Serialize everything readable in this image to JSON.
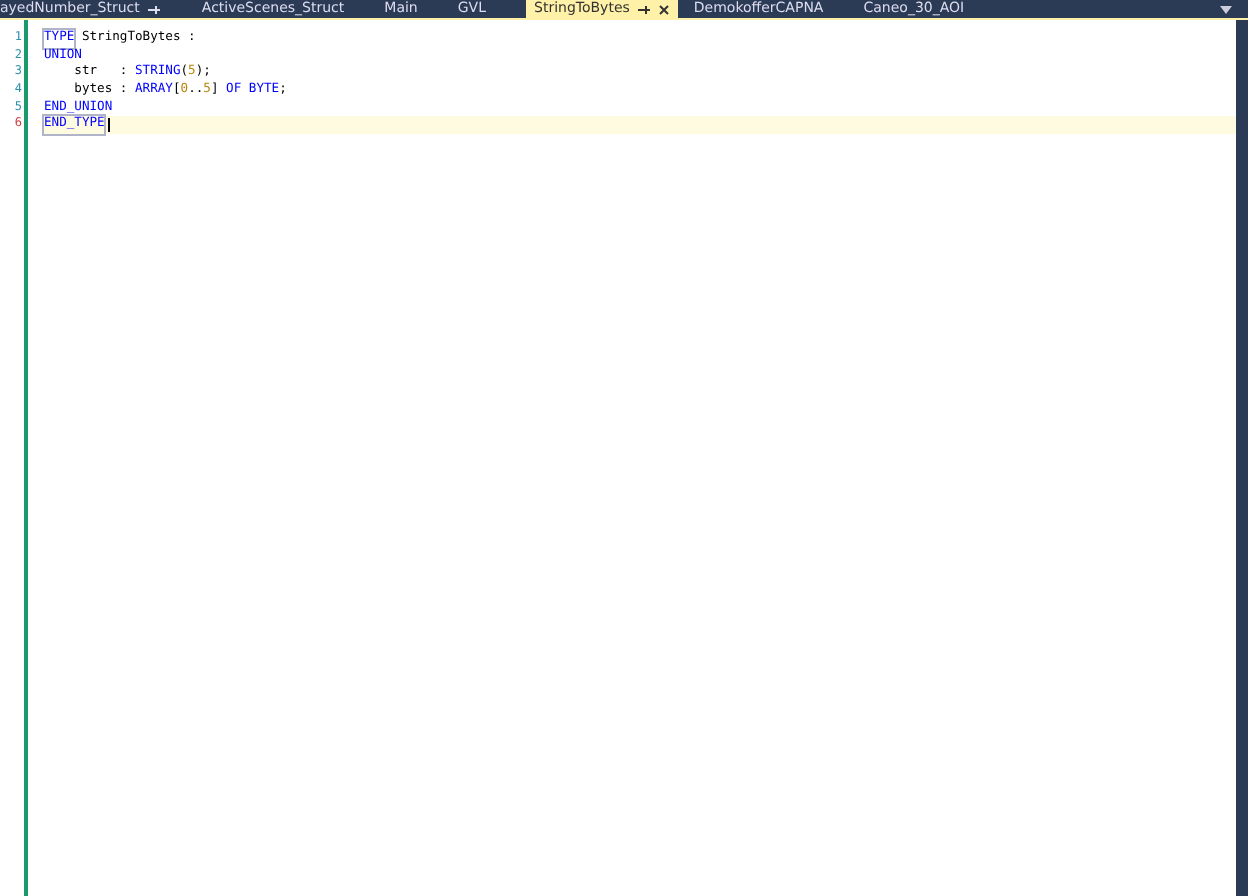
{
  "tabs": [
    {
      "label": "ayedNumber_Struct",
      "selected": false,
      "pinned": true,
      "closable": false
    },
    {
      "label": "ActiveScenes_Struct",
      "selected": false,
      "pinned": false,
      "closable": false
    },
    {
      "label": "Main",
      "selected": false,
      "pinned": false,
      "closable": false
    },
    {
      "label": "GVL",
      "selected": false,
      "pinned": false,
      "closable": false
    },
    {
      "label": "StringToBytes",
      "selected": true,
      "pinned": true,
      "closable": true
    },
    {
      "label": "DemokofferCAPNA",
      "selected": false,
      "pinned": false,
      "closable": false
    },
    {
      "label": "Caneo_30_AOI",
      "selected": false,
      "pinned": false,
      "closable": false
    }
  ],
  "editor": {
    "lines": [
      {
        "number": "1",
        "changed": false,
        "current": false,
        "tokens": [
          {
            "kind": "keyword",
            "text": "TYPE",
            "boxed": true
          },
          {
            "kind": "plain",
            "text": " StringToBytes :"
          }
        ]
      },
      {
        "number": "2",
        "changed": false,
        "current": false,
        "tokens": [
          {
            "kind": "keyword",
            "text": "UNION"
          }
        ]
      },
      {
        "number": "3",
        "changed": false,
        "current": false,
        "tokens": [
          {
            "kind": "plain",
            "text": "    str   : "
          },
          {
            "kind": "keyword",
            "text": "STRING"
          },
          {
            "kind": "plain",
            "text": "("
          },
          {
            "kind": "number",
            "text": "5"
          },
          {
            "kind": "plain",
            "text": ");"
          }
        ]
      },
      {
        "number": "4",
        "changed": false,
        "current": false,
        "tokens": [
          {
            "kind": "plain",
            "text": "    bytes : "
          },
          {
            "kind": "keyword",
            "text": "ARRAY"
          },
          {
            "kind": "plain",
            "text": "["
          },
          {
            "kind": "number",
            "text": "0"
          },
          {
            "kind": "plain",
            "text": ".."
          },
          {
            "kind": "number",
            "text": "5"
          },
          {
            "kind": "plain",
            "text": "] "
          },
          {
            "kind": "keyword",
            "text": "OF BYTE"
          },
          {
            "kind": "plain",
            "text": ";"
          }
        ]
      },
      {
        "number": "5",
        "changed": false,
        "current": false,
        "tokens": [
          {
            "kind": "keyword",
            "text": "END_UNION"
          }
        ]
      },
      {
        "number": "6",
        "changed": true,
        "current": true,
        "tokens": [
          {
            "kind": "keyword",
            "text": "END_TYPE",
            "boxed": true
          }
        ]
      }
    ]
  }
}
